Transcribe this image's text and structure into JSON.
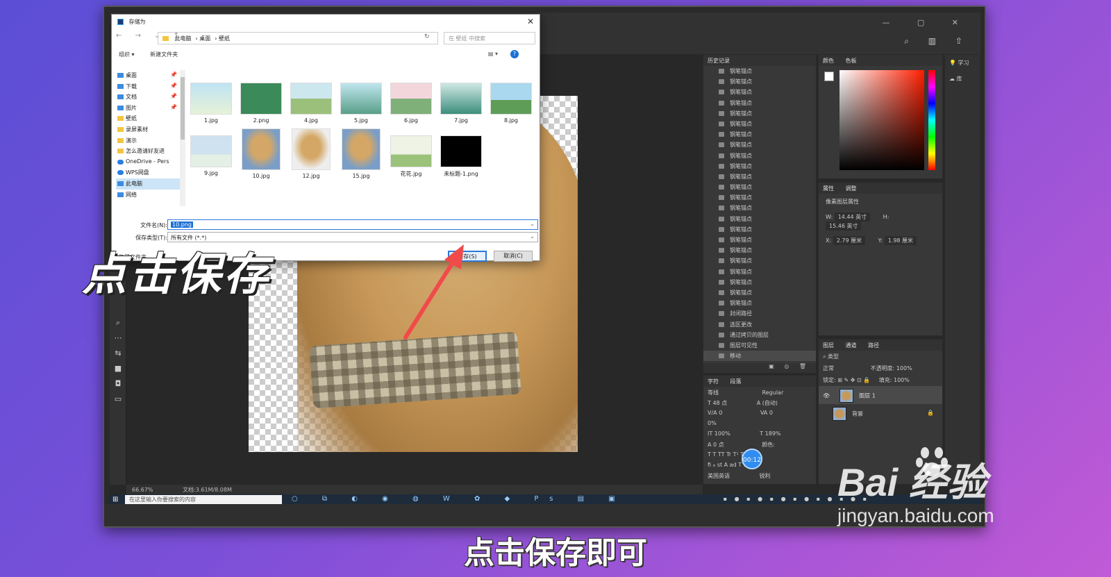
{
  "dialog": {
    "title": "存储为",
    "path": [
      "此电脑",
      "桌面",
      "壁纸"
    ],
    "search_placeholder": "在 壁纸 中搜索",
    "organize": "组织 ▾",
    "new_folder": "新建文件夹",
    "help": "?",
    "nav_items": [
      {
        "label": "桌面",
        "pinned": true,
        "type": "blue"
      },
      {
        "label": "下载",
        "pinned": true,
        "type": "blue"
      },
      {
        "label": "文档",
        "pinned": true,
        "type": "blue"
      },
      {
        "label": "图片",
        "pinned": true,
        "type": "blue"
      },
      {
        "label": "壁纸",
        "pinned": false,
        "type": "folder"
      },
      {
        "label": "录屏素材",
        "pinned": false,
        "type": "folder"
      },
      {
        "label": "演示",
        "pinned": false,
        "type": "folder"
      },
      {
        "label": "怎么邀请好友进",
        "pinned": false,
        "type": "folder"
      },
      {
        "label": "OneDrive - Pers",
        "pinned": false,
        "type": "cloud"
      },
      {
        "label": "WPS网盘",
        "pinned": false,
        "type": "cloud"
      },
      {
        "label": "此电脑",
        "pinned": false,
        "type": "blue",
        "selected": true
      },
      {
        "label": "网络",
        "pinned": false,
        "type": "blue"
      }
    ],
    "files": [
      {
        "name": "1.jpg",
        "style": "t-sky"
      },
      {
        "name": "2.png",
        "style": "t-green"
      },
      {
        "name": "4.jpg",
        "style": "t-field"
      },
      {
        "name": "5.jpg",
        "style": "t-lake"
      },
      {
        "name": "6.jpg",
        "style": "t-pink"
      },
      {
        "name": "7.jpg",
        "style": "t-teal"
      },
      {
        "name": "8.jpg",
        "style": "t-grass"
      },
      {
        "name": "9.jpg",
        "style": "t-snow"
      },
      {
        "name": "10.jpg",
        "style": "t-dog"
      },
      {
        "name": "12.jpg",
        "style": "t-dog2"
      },
      {
        "name": "15.jpg",
        "style": "t-dog"
      },
      {
        "name": "花花.jpg",
        "style": "t-flower"
      },
      {
        "name": "未标题-1.png",
        "style": "t-black"
      }
    ],
    "filename_label": "文件名(N):",
    "filename_value": "10.png",
    "filetype_label": "保存类型(T):",
    "filetype_value": "所有文件 (*.*)",
    "hide_folders": "隐藏文件夹",
    "save_label": "保存(S)",
    "cancel_label": "取消(C)"
  },
  "photoshop": {
    "history_tab": "历史记录",
    "history_items": [
      "钢笔锚点",
      "钢笔锚点",
      "钢笔锚点",
      "钢笔锚点",
      "钢笔锚点",
      "钢笔锚点",
      "钢笔锚点",
      "钢笔锚点",
      "钢笔锚点",
      "钢笔锚点",
      "钢笔锚点",
      "钢笔锚点",
      "钢笔锚点",
      "钢笔锚点",
      "钢笔锚点",
      "钢笔锚点",
      "钢笔锚点",
      "钢笔锚点",
      "钢笔锚点",
      "钢笔锚点",
      "钢笔锚点",
      "钢笔锚点",
      "钢笔锚点",
      "封闭路径",
      "选区更改",
      "通过拷贝的图层",
      "图层可见性",
      "移动"
    ],
    "char_tabs": [
      "字符",
      "段落"
    ],
    "char_font": "等线",
    "char_style": "Regular",
    "char_size": "48 点",
    "char_leading": "(自动)",
    "char_kern": "0",
    "char_track": "0",
    "char_scale": "0%",
    "char_vscale": "100%",
    "char_hscale": "189%",
    "char_baseline": "0 点",
    "char_color_label": "颜色:",
    "char_lang": "美国英语",
    "char_aa": "锐利",
    "color_tabs": [
      "颜色",
      "色板"
    ],
    "props_tabs": [
      "属性",
      "调整"
    ],
    "props_title": "像素图层属性",
    "props_w": "14.44 英寸",
    "props_h": "15.46 英寸",
    "props_x": "2.79 厘米",
    "props_y": "1.98 厘米",
    "layers_tabs": [
      "图层",
      "通道",
      "路径"
    ],
    "layers_kind": "类型",
    "blend_mode": "正常",
    "opacity_label": "不透明度:",
    "opacity_value": "100%",
    "lock_label": "锁定:",
    "fill_label": "填充:",
    "fill_value": "100%",
    "layers": [
      {
        "name": "图层 1",
        "active": true,
        "locked": false
      },
      {
        "name": "背景",
        "active": false,
        "locked": true
      }
    ],
    "right_items": [
      "学习",
      "库"
    ],
    "zoom": "66.67%",
    "doc_info": "文档:3.61M/8.08M"
  },
  "taskbar": {
    "search_placeholder": "在这里输入你要搜索的内容"
  },
  "overlay": {
    "title": "点击保存",
    "caption": "点击保存即可",
    "timer": "00:12",
    "brand": "Bai 经验",
    "url": "jingyan.baidu.com"
  },
  "colors": {
    "accent": "#2a78d6",
    "arrow": "#f04a4a",
    "ps_bg": "#282828"
  }
}
